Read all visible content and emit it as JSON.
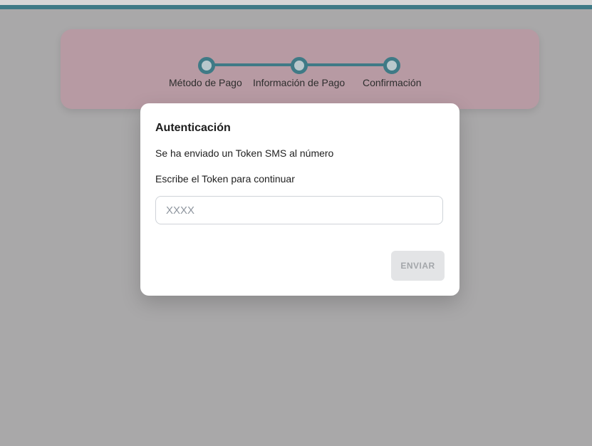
{
  "stepper": {
    "steps": [
      {
        "label": "Método de Pago"
      },
      {
        "label": "Información de Pago"
      },
      {
        "label": "Confirmación"
      }
    ]
  },
  "modal": {
    "title": "Autenticación",
    "message": "Se ha enviado un Token SMS al número",
    "instruction": "Escribe el Token para continuar",
    "token_placeholder": "XXXX",
    "token_value": "",
    "submit_label": "ENVIAR",
    "submit_enabled": false
  },
  "colors": {
    "accent": "#3f7a86",
    "overlay": "#a9a8a9",
    "stepper_bg": "#b79aa3"
  }
}
